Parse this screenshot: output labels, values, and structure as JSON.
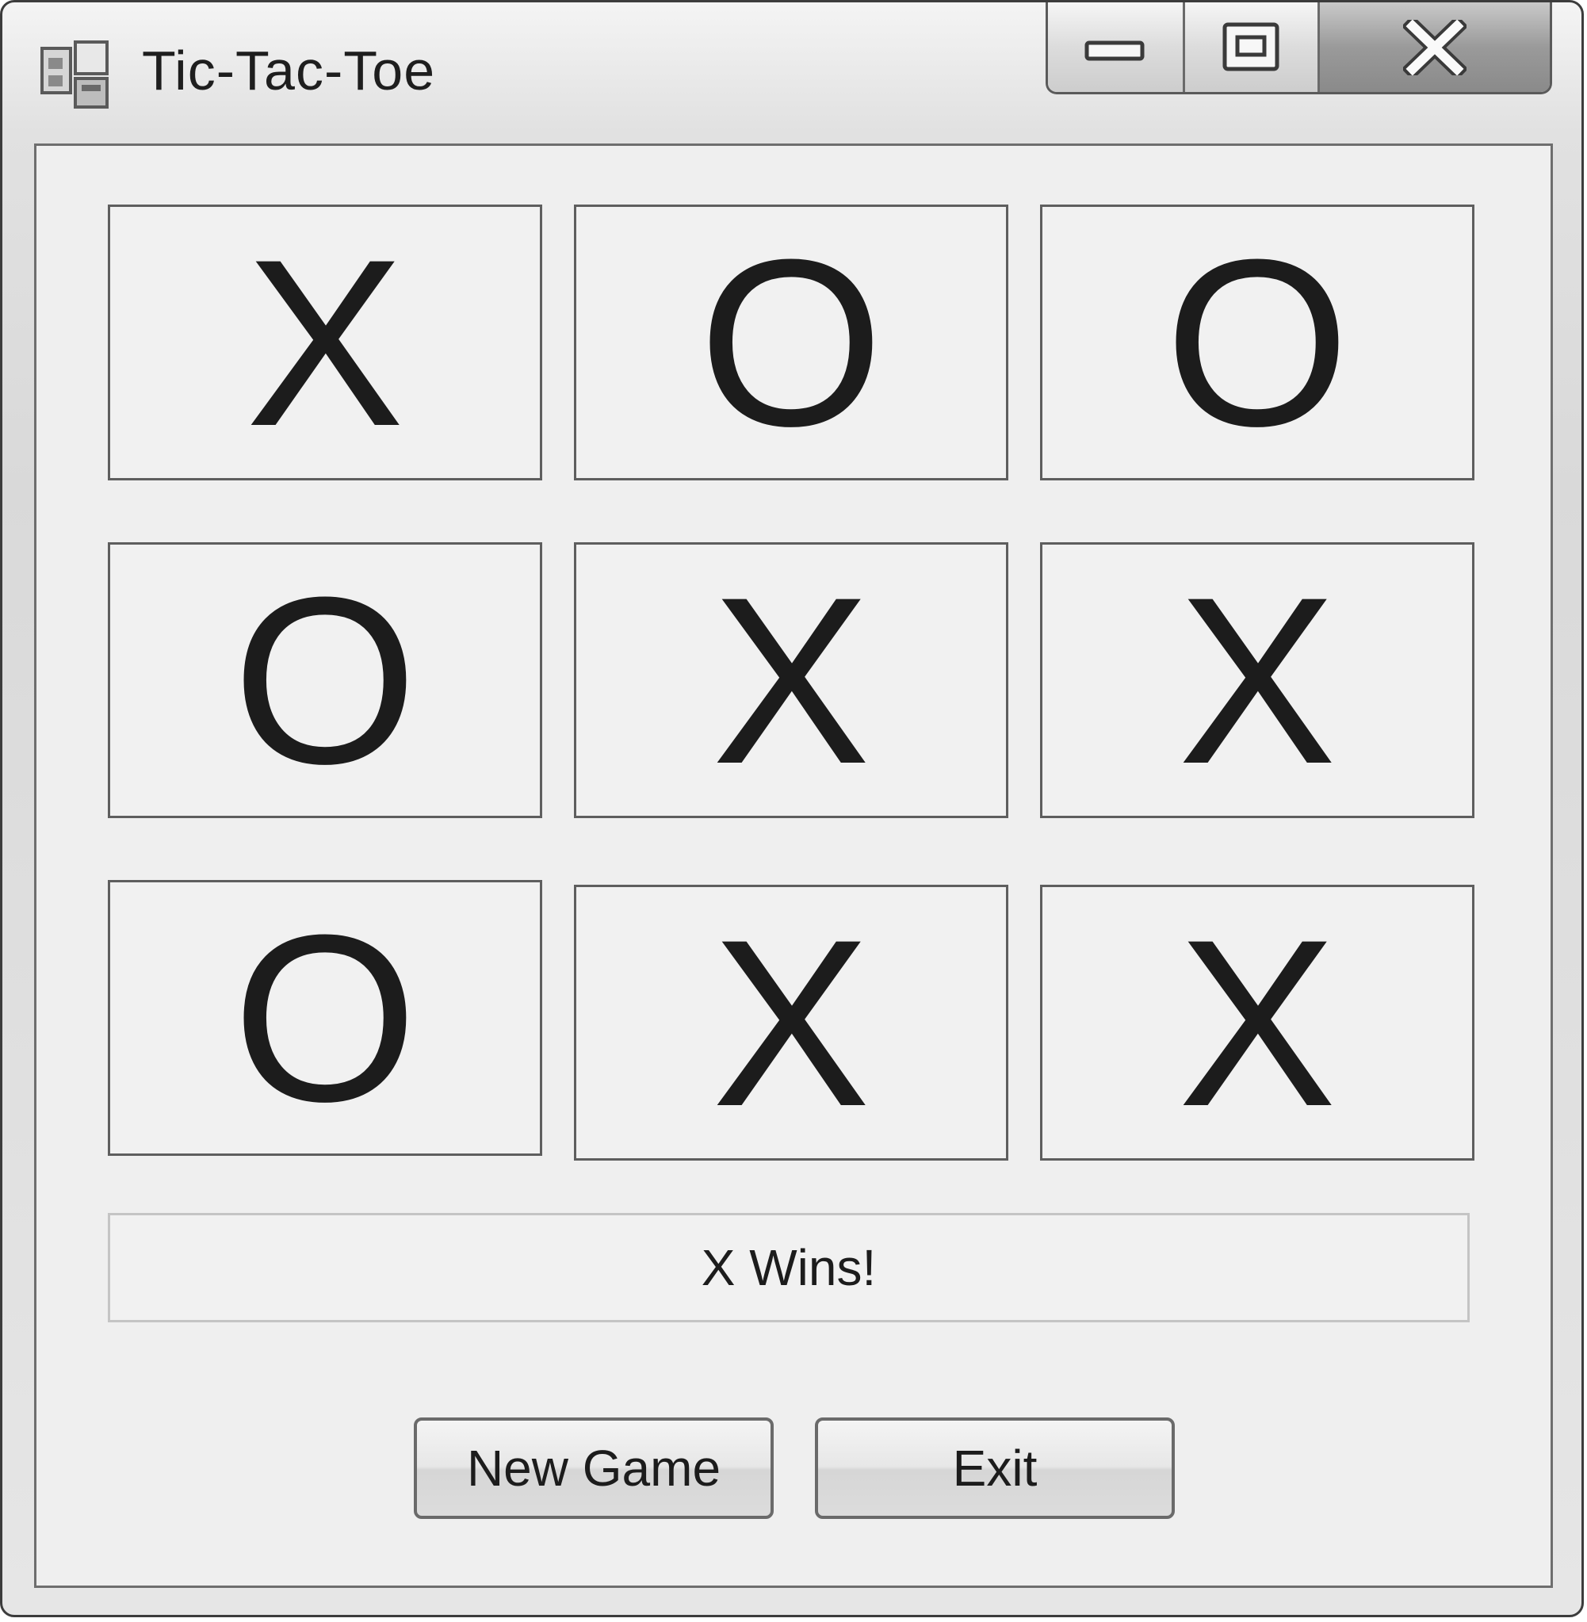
{
  "window": {
    "title": "Tic-Tac-Toe",
    "app_icon": "form-window-icon",
    "caption_buttons": {
      "minimize_icon": "minimize-icon",
      "maximize_icon": "maximize-icon",
      "close_icon": "close-icon"
    }
  },
  "board": {
    "rows": [
      [
        "X",
        "O",
        "O"
      ],
      [
        "O",
        "X",
        "X"
      ],
      [
        "O",
        "X",
        "X"
      ]
    ]
  },
  "status": {
    "text": "X Wins!"
  },
  "buttons": {
    "new_game": "New Game",
    "exit": "Exit"
  },
  "colors": {
    "mark": "#1c1c1c",
    "cell_background": "#f1f1f1",
    "form_background": "#efefef"
  }
}
